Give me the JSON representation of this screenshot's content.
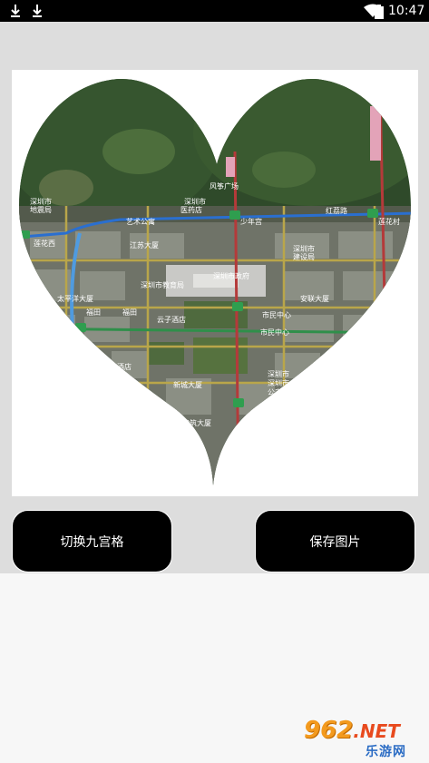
{
  "status_bar": {
    "time": "10:47",
    "icons": [
      "download-icon",
      "download-icon",
      "wifi-icon",
      "battery-icon"
    ]
  },
  "heart_map": {
    "labels": [
      {
        "name": "map-label-fengzheng",
        "text": "风筝广场"
      },
      {
        "name": "map-label-shenzhenshi-1",
        "text": "深圳市"
      },
      {
        "name": "map-label-dizhen",
        "text": "地震局"
      },
      {
        "name": "map-label-shenzhenshi-yinyue",
        "text": "深圳市"
      },
      {
        "name": "map-label-yiyuan",
        "text": "医药店"
      },
      {
        "name": "map-label-shaoniangong",
        "text": "少年宫"
      },
      {
        "name": "map-label-hongli",
        "text": "红荔路"
      },
      {
        "name": "map-label-lianhuacun",
        "text": "莲花村"
      },
      {
        "name": "map-label-lianhuaxi",
        "text": "莲花西"
      },
      {
        "name": "map-label-yiwen",
        "text": "艺术公寓"
      },
      {
        "name": "map-label-jiangsu",
        "text": "江苏大厦"
      },
      {
        "name": "map-label-zhengfu",
        "text": "深圳市政府"
      },
      {
        "name": "map-label-jiaoyuju",
        "text": "深圳市教育局"
      },
      {
        "name": "map-label-shenyinshan",
        "text": "深圳市"
      },
      {
        "name": "map-label-jianshe",
        "text": "建设局"
      },
      {
        "name": "map-label-taiping",
        "text": "太平洋大厦"
      },
      {
        "name": "map-label-anlian",
        "text": "安联大厦"
      },
      {
        "name": "map-label-yunzi",
        "text": "云子酒店"
      },
      {
        "name": "map-label-shiminzhongxin-1",
        "text": "市民中心"
      },
      {
        "name": "map-label-shiminzhongxin-2",
        "text": "市民中心"
      },
      {
        "name": "map-label-futian-1",
        "text": "福田"
      },
      {
        "name": "map-label-futian-2",
        "text": "福田"
      },
      {
        "name": "map-label-shimao",
        "text": "世茂酒店"
      },
      {
        "name": "map-label-xincheng",
        "text": "新城大厦"
      },
      {
        "name": "map-label-shenzhenshi-2",
        "text": "深圳市"
      },
      {
        "name": "map-label-jianyuan",
        "text": "建筑大厦"
      },
      {
        "name": "map-label-dongyuan",
        "text": "深圳市"
      },
      {
        "name": "map-label-gongan",
        "text": "公安局"
      }
    ]
  },
  "buttons": {
    "grid_label": "切换九宫格",
    "save_label": "保存图片"
  },
  "watermark": {
    "brand_num": "962",
    "brand_net": ".NET",
    "sub": "乐游网"
  }
}
